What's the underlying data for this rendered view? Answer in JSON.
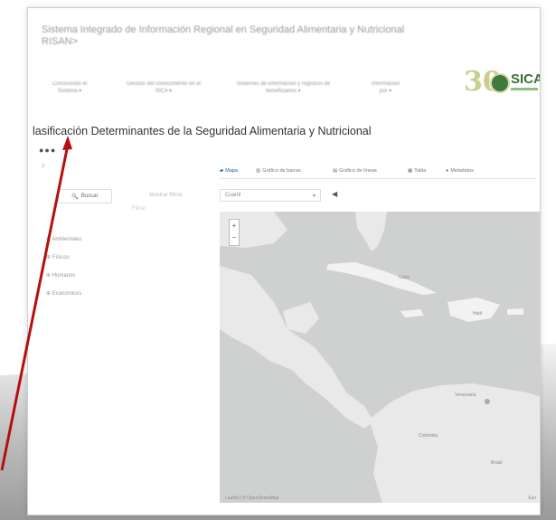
{
  "header": {
    "site_title_line1": "Sistema Integrado de Información Regional en Seguridad Alimentaria y Nutricional",
    "site_title_line2": "RISAN>"
  },
  "nav": [
    {
      "label": "Conociendo el",
      "sub": "Sistema ▾"
    },
    {
      "label": "Gestión del conocimiento en el",
      "sub": "SICA ▾"
    },
    {
      "label": "Sistemas de información y registros de",
      "sub": "beneficiarios ▾"
    },
    {
      "label": "Información",
      "sub": "por ▾"
    }
  ],
  "logo": {
    "number": "30",
    "brand": "SICA"
  },
  "main": {
    "title": "lasificación Determinantes de la Seguridad Alimentaria y Nutricional",
    "dots": "●●●"
  },
  "sidebar": {
    "small_label": "≡",
    "buscar": "Buscar",
    "mostrar": "Mostrar filtros",
    "filtro": "Filtrar",
    "items": [
      "Ambientales",
      "Físicos",
      "Humanos",
      "Económicos"
    ]
  },
  "tabs": [
    "Mapa",
    "Gráfico de barras",
    "Gráfico de líneas",
    "Tabla",
    "Metadatos"
  ],
  "select": {
    "value": "Cuartil"
  },
  "map": {
    "labels": [
      "Cuba",
      "Haití",
      "Venezuela",
      "Colombia",
      "Brasil"
    ],
    "zoom_in": "+",
    "zoom_out": "−",
    "footer_left": "Leaflet | © OpenStreetMap",
    "footer_right": "Esri"
  },
  "colors": {
    "accent": "#1b5fa3",
    "sea": "#cfd0d0",
    "land": "#e9e9e9",
    "arrow": "#b50f0f",
    "logo_green": "#3b6e35"
  }
}
